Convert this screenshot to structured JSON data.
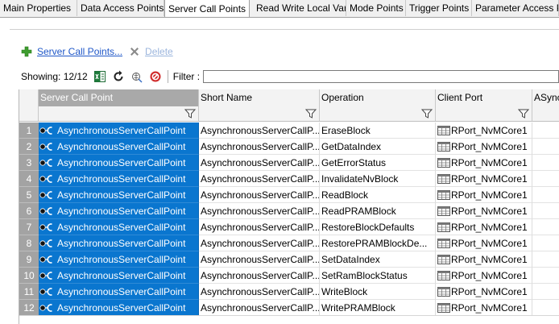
{
  "tabs": [
    {
      "label": "Main Properties",
      "active": false
    },
    {
      "label": "Data Access Points",
      "active": false
    },
    {
      "label": "Server Call Points",
      "active": true
    },
    {
      "label": "Read Write Local Var",
      "active": false
    },
    {
      "label": "Mode Points",
      "active": false
    },
    {
      "label": "Trigger Points",
      "active": false
    },
    {
      "label": "Parameter Access Po",
      "active": false
    }
  ],
  "toolbar": {
    "add_label": "Server Call Points...",
    "delete_label": "Delete",
    "showing": "Showing: 12/12",
    "filter_label": "Filter :",
    "filter_value": ""
  },
  "icons": {
    "add": "plus-icon",
    "delete": "delete-x-icon",
    "excel": "excel-export-icon",
    "refresh": "refresh-icon",
    "filter_clear": "clear-filter-icon",
    "no_entry": "no-entry-icon"
  },
  "colors": {
    "selection": "#0a76cf",
    "row_header": "#a3a3a3",
    "link": "#1f57c8",
    "add_icon": "#3e9c2f",
    "no_entry": "#d02a2a"
  },
  "columns": [
    "Server Call Point",
    "Short Name",
    "Operation",
    "Client Port",
    "ASync"
  ],
  "rows": [
    {
      "num": "1",
      "scp": "AsynchronousServerCallPoint",
      "short": "AsynchronousServerCallP...",
      "operation": "EraseBlock",
      "port": "RPort_NvMCore1"
    },
    {
      "num": "2",
      "scp": "AsynchronousServerCallPoint",
      "short": "AsynchronousServerCallP...",
      "operation": "GetDataIndex",
      "port": "RPort_NvMCore1"
    },
    {
      "num": "3",
      "scp": "AsynchronousServerCallPoint",
      "short": "AsynchronousServerCallP...",
      "operation": "GetErrorStatus",
      "port": "RPort_NvMCore1"
    },
    {
      "num": "4",
      "scp": "AsynchronousServerCallPoint",
      "short": "AsynchronousServerCallP...",
      "operation": "InvalidateNvBlock",
      "port": "RPort_NvMCore1"
    },
    {
      "num": "5",
      "scp": "AsynchronousServerCallPoint",
      "short": "AsynchronousServerCallP...",
      "operation": "ReadBlock",
      "port": "RPort_NvMCore1"
    },
    {
      "num": "6",
      "scp": "AsynchronousServerCallPoint",
      "short": "AsynchronousServerCallP...",
      "operation": "ReadPRAMBlock",
      "port": "RPort_NvMCore1"
    },
    {
      "num": "7",
      "scp": "AsynchronousServerCallPoint",
      "short": "AsynchronousServerCallP...",
      "operation": "RestoreBlockDefaults",
      "port": "RPort_NvMCore1"
    },
    {
      "num": "8",
      "scp": "AsynchronousServerCallPoint",
      "short": "AsynchronousServerCallP...",
      "operation": "RestorePRAMBlockDe...",
      "port": "RPort_NvMCore1"
    },
    {
      "num": "9",
      "scp": "AsynchronousServerCallPoint",
      "short": "AsynchronousServerCallP...",
      "operation": "SetDataIndex",
      "port": "RPort_NvMCore1"
    },
    {
      "num": "10",
      "scp": "AsynchronousServerCallPoint",
      "short": "AsynchronousServerCallP...",
      "operation": "SetRamBlockStatus",
      "port": "RPort_NvMCore1"
    },
    {
      "num": "11",
      "scp": "AsynchronousServerCallPoint",
      "short": "AsynchronousServerCallP...",
      "operation": "WriteBlock",
      "port": "RPort_NvMCore1"
    },
    {
      "num": "12",
      "scp": "AsynchronousServerCallPoint",
      "short": "AsynchronousServerCallP...",
      "operation": "WritePRAMBlock",
      "port": "RPort_NvMCore1"
    }
  ]
}
